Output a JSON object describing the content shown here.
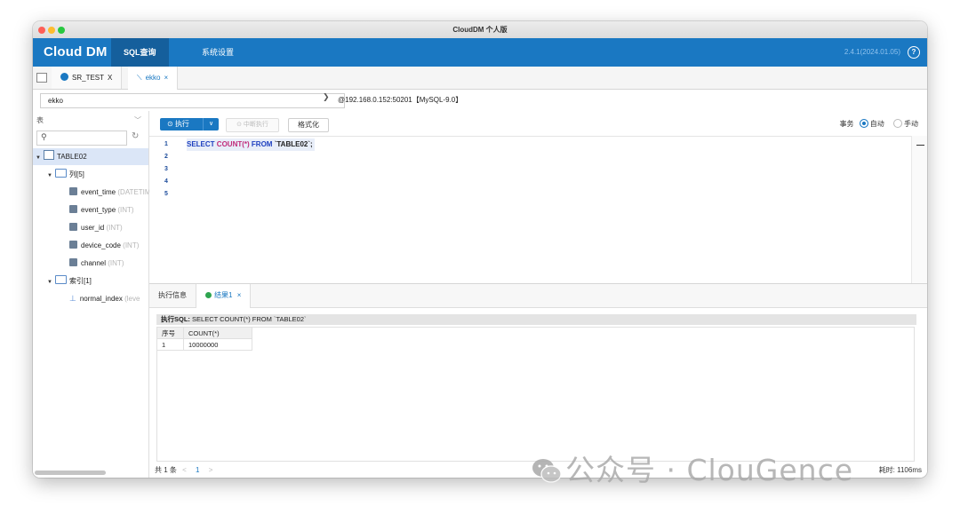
{
  "window": {
    "title": "CloudDM 个人版"
  },
  "navbar": {
    "logo": "Cloud DM",
    "tabs": [
      {
        "label": "SQL查询",
        "active": true
      },
      {
        "label": "系统设置",
        "active": false
      }
    ],
    "version": "2.4.1(2024.01.05)",
    "help": "?"
  },
  "tabbar": {
    "tabs": [
      {
        "label": "SR_TEST",
        "close": "X",
        "icon": "connection-icon"
      },
      {
        "label": "ekko",
        "close": "×",
        "icon": "query-icon"
      }
    ]
  },
  "connbar": {
    "database": "ekko",
    "connection_info": "@192.168.0.152:50201【MySQL-9.0】"
  },
  "sidebar": {
    "object_type": "表",
    "search_placeholder": "",
    "tree": {
      "table": "TABLE02",
      "columns_folder": "列[5]",
      "columns": [
        {
          "name": "event_time",
          "type": "(DATETIME)"
        },
        {
          "name": "event_type",
          "type": "(INT)"
        },
        {
          "name": "user_id",
          "type": "(INT)"
        },
        {
          "name": "device_code",
          "type": "(INT)"
        },
        {
          "name": "channel",
          "type": "(INT)"
        }
      ],
      "index_folder": "索引[1]",
      "indexes": [
        {
          "name": "normal_index",
          "type": "(leve"
        }
      ]
    }
  },
  "toolbar": {
    "execute": "执行",
    "stop": "中断执行",
    "format": "格式化",
    "transaction_label": "事务",
    "mode_auto": "自动",
    "mode_manual": "手动",
    "selected_mode": "自动"
  },
  "editor": {
    "line_numbers": [
      "1",
      "2",
      "3",
      "4",
      "5"
    ],
    "code": {
      "kw_select": "SELECT",
      "fn_count": "COUNT(*)",
      "kw_from": "FROM",
      "table": "`TABLE02`;"
    }
  },
  "results": {
    "tabs": {
      "info": "执行信息",
      "result": "结果1",
      "close": "×"
    },
    "executed_sql_label": "执行SQL:",
    "executed_sql": "SELECT COUNT(*) FROM `TABLE02`",
    "columns": [
      "序号",
      "COUNT(*)"
    ],
    "rows": [
      [
        "1",
        "10000000"
      ]
    ],
    "pager": {
      "total": "共 1 条",
      "prev": "<",
      "page": "1",
      "next": ">"
    },
    "time": "耗时: 1106ms"
  },
  "watermark": {
    "text": "公众号 · ClouGence"
  },
  "colors": {
    "brand": "#1a78c2",
    "brand_dark": "#155f9c",
    "success": "#2ea44f"
  }
}
